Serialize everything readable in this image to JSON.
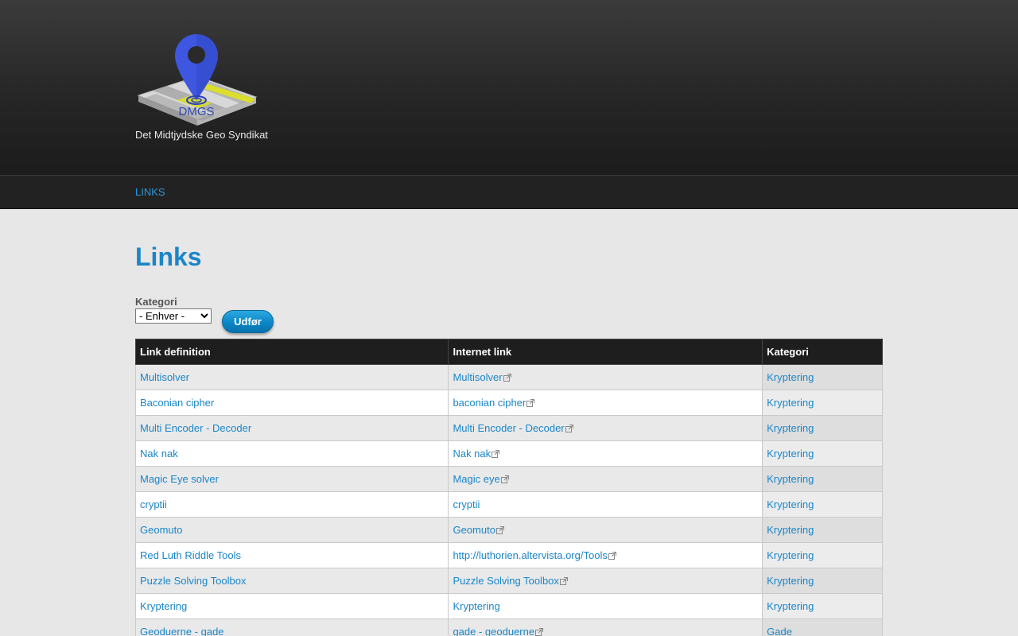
{
  "header": {
    "logo_text": "DMGS",
    "slogan": "Det Midtjydske Geo Syndikat"
  },
  "nav": {
    "items": [
      {
        "label": "LINKS"
      }
    ]
  },
  "page": {
    "title": "Links"
  },
  "filter": {
    "label": "Kategori",
    "selected": "- Enhver -",
    "submit_label": "Udfør"
  },
  "table": {
    "headers": [
      "Link definition",
      "Internet link",
      "Kategori"
    ],
    "rows": [
      {
        "definition": "Multisolver",
        "link": "Multisolver",
        "external": true,
        "category": "Kryptering"
      },
      {
        "definition": "Baconian cipher",
        "link": "baconian cipher",
        "external": true,
        "category": "Kryptering"
      },
      {
        "definition": "Multi Encoder - Decoder",
        "link": "Multi Encoder - Decoder",
        "external": true,
        "category": "Kryptering"
      },
      {
        "definition": "Nak nak",
        "link": "Nak nak",
        "external": true,
        "category": "Kryptering"
      },
      {
        "definition": "Magic Eye solver",
        "link": "Magic eye",
        "external": true,
        "category": "Kryptering"
      },
      {
        "definition": "cryptii",
        "link": "cryptii",
        "external": false,
        "category": "Kryptering"
      },
      {
        "definition": "Geomuto",
        "link": "Geomuto",
        "external": true,
        "category": "Kryptering"
      },
      {
        "definition": "Red Luth Riddle Tools",
        "link": "http://luthorien.altervista.org/Tools",
        "external": true,
        "category": "Kryptering"
      },
      {
        "definition": "Puzzle Solving Toolbox",
        "link": "Puzzle Solving Toolbox",
        "external": true,
        "category": "Kryptering"
      },
      {
        "definition": "Kryptering",
        "link": "Kryptering",
        "external": false,
        "category": "Kryptering"
      },
      {
        "definition": "Geoduerne - gade",
        "link": "gade - geoduerne",
        "external": true,
        "category": "Gade"
      }
    ]
  },
  "colors": {
    "link": "#1a86c8",
    "header_bg": "#262626",
    "pin": "#3f57e0",
    "map_yellow": "#d9df2a"
  },
  "icons": {
    "external": "external-link-icon",
    "logo": "map-pin-logo-icon"
  }
}
